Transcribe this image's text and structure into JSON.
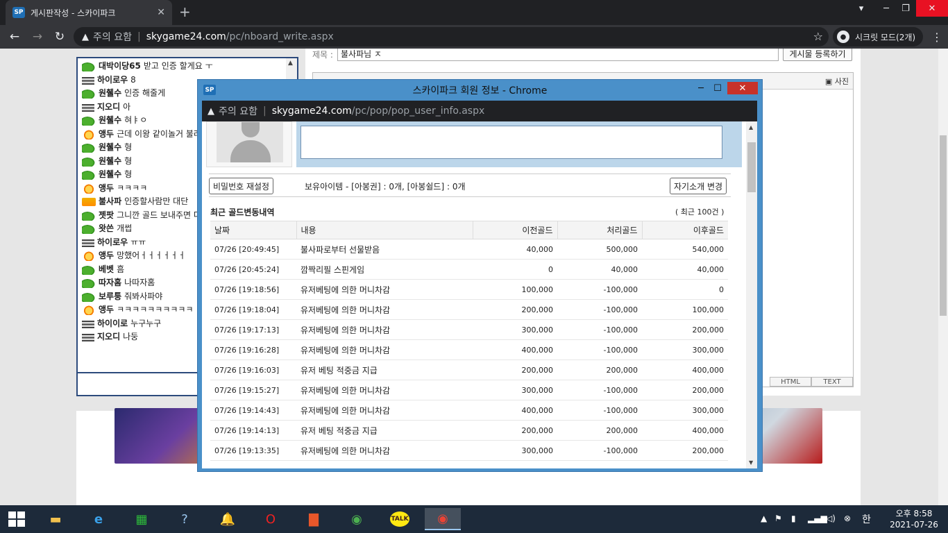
{
  "browser": {
    "tab_title": "게시판작성 - 스카이파크",
    "favicon_text": "SP",
    "new_tab_glyph": "+",
    "security_label": "주의 요함",
    "url_host": "skygame24.com",
    "url_path": "/pc/nboard_write.aspx",
    "incognito_label": "시크릿 모드(2개)"
  },
  "chat": {
    "messages": [
      {
        "level": "leaf",
        "name": "대박이당65",
        "text": "받고 인증 할게요 ㅜ"
      },
      {
        "level": "bar",
        "name": "하이로우",
        "text": "8"
      },
      {
        "level": "leaf",
        "name": "원췔수",
        "text": "인증 해줄게"
      },
      {
        "level": "bar",
        "name": "지오디",
        "text": "아"
      },
      {
        "level": "leaf",
        "name": "원췔수",
        "text": "혀ㅑㅇ"
      },
      {
        "level": "heart",
        "name": "앵두",
        "text": "근데 이왕 같이놀거 불러주고 놀면안대?"
      },
      {
        "level": "leaf",
        "name": "원췔수",
        "text": "형"
      },
      {
        "level": "leaf",
        "name": "원췔수",
        "text": "형"
      },
      {
        "level": "leaf",
        "name": "원췔수",
        "text": "형"
      },
      {
        "level": "heart",
        "name": "앵두",
        "text": "ㅋㅋㅋㅋ"
      },
      {
        "level": "gold",
        "name": "불사파",
        "text": "인증할사람만 대단"
      },
      {
        "level": "leaf",
        "name": "젯팟",
        "text": "그니깐 골드 보내주면 다고"
      },
      {
        "level": "leaf",
        "name": "왓쓴",
        "text": "개썹"
      },
      {
        "level": "bar",
        "name": "하이로우",
        "text": "ㅠㅠ"
      },
      {
        "level": "heart",
        "name": "앵두",
        "text": "망했어ㅓㅓㅓㅓㅓㅓ"
      },
      {
        "level": "leaf",
        "name": "베벳",
        "text": "흠"
      },
      {
        "level": "leaf",
        "name": "따자홈",
        "text": "나따자홈"
      },
      {
        "level": "leaf",
        "name": "보루퉁",
        "text": "줘봐사파야"
      },
      {
        "level": "heart",
        "name": "앵두",
        "text": "ㅋㅋㅋㅋㅋㅋㅋㅋㅋㅋ"
      },
      {
        "level": "bar",
        "name": "하이이로",
        "text": "누구누구"
      },
      {
        "level": "bar",
        "name": "지오디",
        "text": "나둥"
      }
    ]
  },
  "post": {
    "subject_label": "제목 :",
    "subject_value": "불사파님 ㅈ",
    "submit_label": "게시물 등록하기",
    "photo_label": "사진",
    "mode_html": "HTML",
    "mode_text": "TEXT"
  },
  "popup": {
    "icon_text": "SP",
    "title": "스카이파크 회원 정보 - Chrome",
    "security_label": "주의 요함",
    "url_host": "skygame24.com",
    "url_path": "/pc/pop/pop_user_info.aspx",
    "reset_password_label": "비밀번호 재설정",
    "items_text": "보유아이템 - [아봉권] : 0개, [아봉쉴드] : 0개",
    "change_intro_label": "자기소개 변경",
    "history_title": "최근 골드변동내역",
    "history_count": "( 최근 100건 )",
    "columns": [
      "날짜",
      "내용",
      "이전골드",
      "처리골드",
      "이후골드"
    ],
    "rows": [
      [
        "07/26 [20:49:45]",
        "불사파로부터 선물받음",
        "40,000",
        "500,000",
        "540,000"
      ],
      [
        "07/26 [20:45:24]",
        "깜짝리필 스핀게임",
        "0",
        "40,000",
        "40,000"
      ],
      [
        "07/26 [19:18:56]",
        "유저베팅에 의한 머니차감",
        "100,000",
        "-100,000",
        "0"
      ],
      [
        "07/26 [19:18:04]",
        "유저베팅에 의한 머니차감",
        "200,000",
        "-100,000",
        "100,000"
      ],
      [
        "07/26 [19:17:13]",
        "유저베팅에 의한 머니차감",
        "300,000",
        "-100,000",
        "200,000"
      ],
      [
        "07/26 [19:16:28]",
        "유저베팅에 의한 머니차감",
        "400,000",
        "-100,000",
        "300,000"
      ],
      [
        "07/26 [19:16:03]",
        "유저 베팅 적중금 지급",
        "200,000",
        "200,000",
        "400,000"
      ],
      [
        "07/26 [19:15:27]",
        "유저베팅에 의한 머니차감",
        "300,000",
        "-100,000",
        "200,000"
      ],
      [
        "07/26 [19:14:43]",
        "유저베팅에 의한 머니차감",
        "400,000",
        "-100,000",
        "300,000"
      ],
      [
        "07/26 [19:14:13]",
        "유저 베팅 적중금 지급",
        "200,000",
        "200,000",
        "400,000"
      ],
      [
        "07/26 [19:13:35]",
        "유저베팅에 의한 머니차감",
        "300,000",
        "-100,000",
        "200,000"
      ]
    ]
  },
  "taskbar": {
    "kakao_label": "TALK",
    "ime_label": "한",
    "clock_ampm_time": "오후 8:58",
    "clock_date": "2021-07-26"
  }
}
